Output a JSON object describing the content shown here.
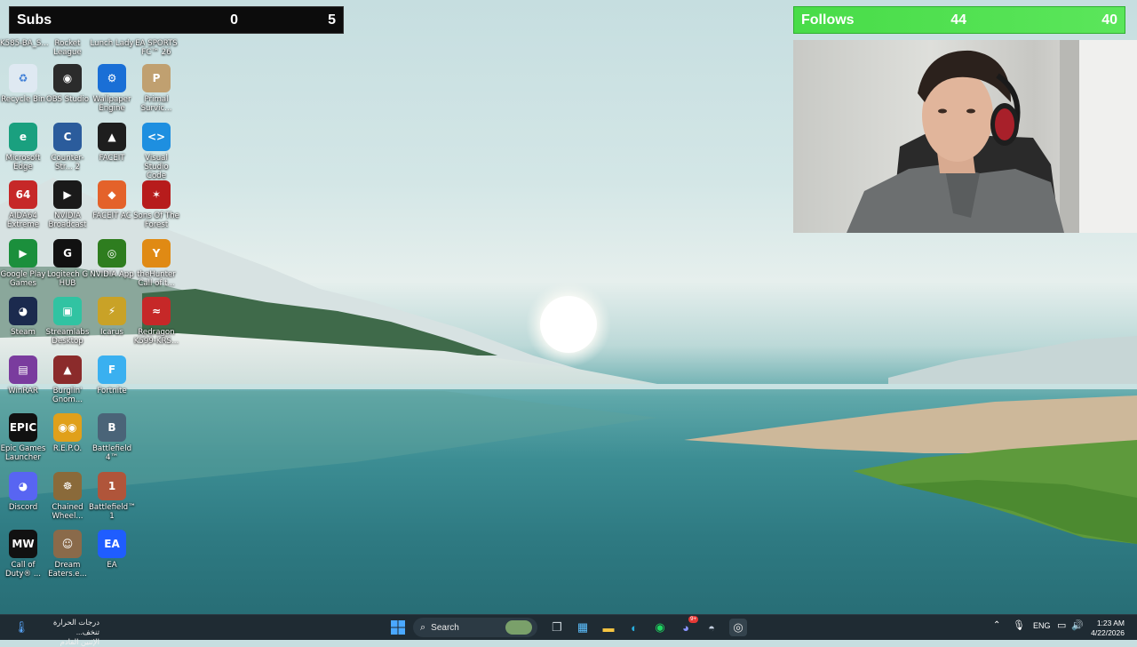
{
  "overlay": {
    "subs": {
      "label": "Subs",
      "current": "0",
      "goal": "5"
    },
    "follows": {
      "label": "Follows",
      "current": "44",
      "goal": "40"
    }
  },
  "top_labels": [
    "K585-BA_S...",
    "Rocket League",
    "Lunch Lady",
    "EA SPORTS FC™ 26"
  ],
  "icons": [
    {
      "label": "Recycle Bin",
      "icon": "recycle-bin-icon",
      "color": "#dfe9f2",
      "glyph": "♻"
    },
    {
      "label": "OBS Studio",
      "icon": "obs-icon",
      "color": "#2b2b2b",
      "glyph": "◉"
    },
    {
      "label": "Wallpaper Engine",
      "icon": "wallpaper-engine-icon",
      "color": "#1a6fd6",
      "glyph": "⚙"
    },
    {
      "label": "Primal Survic...",
      "icon": "primal-survival-icon",
      "color": "#c0a070",
      "glyph": "P"
    },
    {
      "label": "Microsoft Edge",
      "icon": "edge-icon",
      "color": "#1aa07f",
      "glyph": "e"
    },
    {
      "label": "Counter-Str... 2",
      "icon": "counter-strike-icon",
      "color": "#2b5c9c",
      "glyph": "C"
    },
    {
      "label": "FACEIT",
      "icon": "faceit-icon",
      "color": "#1e1e1e",
      "glyph": "▲"
    },
    {
      "label": "Visual Studio Code",
      "icon": "vscode-icon",
      "color": "#1e8fe0",
      "glyph": "<>"
    },
    {
      "label": "AIDA64 Extreme",
      "icon": "aida64-icon",
      "color": "#c62828",
      "glyph": "64"
    },
    {
      "label": "NVIDIA Broadcast",
      "icon": "nvidia-broadcast-icon",
      "color": "#1a1a1a",
      "glyph": "▶"
    },
    {
      "label": "FACEIT AC",
      "icon": "faceit-ac-icon",
      "color": "#e4622a",
      "glyph": "◆"
    },
    {
      "label": "Sons Of The Forest",
      "icon": "sons-of-the-forest-icon",
      "color": "#b71c1c",
      "glyph": "✶"
    },
    {
      "label": "Google Play Games",
      "icon": "google-play-games-icon",
      "color": "#1b8f3c",
      "glyph": "▶"
    },
    {
      "label": "Logitech G HUB",
      "icon": "logitech-ghub-icon",
      "color": "#111",
      "glyph": "G"
    },
    {
      "label": "NVIDIA App",
      "icon": "nvidia-app-icon",
      "color": "#2e7d1f",
      "glyph": "◎"
    },
    {
      "label": "theHunter Call of t...",
      "icon": "thehunter-icon",
      "color": "#e08a14",
      "glyph": "Y"
    },
    {
      "label": "Steam",
      "icon": "steam-icon",
      "color": "#1b2a4e",
      "glyph": "◕"
    },
    {
      "label": "Streamlabs Desktop",
      "icon": "streamlabs-icon",
      "color": "#31c3a2",
      "glyph": "▣"
    },
    {
      "label": "Icarus",
      "icon": "icarus-icon",
      "color": "#c9a227",
      "glyph": "⚡"
    },
    {
      "label": "Redragon K599-KRS...",
      "icon": "redragon-icon",
      "color": "#c62828",
      "glyph": "≈"
    },
    {
      "label": "WinRAR",
      "icon": "winrar-icon",
      "color": "#7a3c9e",
      "glyph": "▤"
    },
    {
      "label": "Burglin' Gnom...",
      "icon": "burglin-gnomes-icon",
      "color": "#8b2b2b",
      "glyph": "▲"
    },
    {
      "label": "Fortnite",
      "icon": "fortnite-icon",
      "color": "#3ab0f0",
      "glyph": "F"
    },
    {
      "label": "",
      "icon": "",
      "color": "",
      "glyph": ""
    },
    {
      "label": "Epic Games Launcher",
      "icon": "epic-games-icon",
      "color": "#111",
      "glyph": "EPIC"
    },
    {
      "label": "R.E.P.O.",
      "icon": "repo-icon",
      "color": "#e0a01a",
      "glyph": "◉◉"
    },
    {
      "label": "Battlefield 4™",
      "icon": "battlefield4-icon",
      "color": "#4a6478",
      "glyph": "B"
    },
    {
      "label": "",
      "icon": "",
      "color": "",
      "glyph": ""
    },
    {
      "label": "Discord",
      "icon": "discord-icon",
      "color": "#5865f2",
      "glyph": "◕"
    },
    {
      "label": "Chained Wheel...",
      "icon": "chained-wheels-icon",
      "color": "#8a6a3a",
      "glyph": "☸"
    },
    {
      "label": "Battlefield™ 1",
      "icon": "battlefield1-icon",
      "color": "#b0553a",
      "glyph": "1"
    },
    {
      "label": "",
      "icon": "",
      "color": "",
      "glyph": ""
    },
    {
      "label": "Call of Duty® ...",
      "icon": "call-of-duty-icon",
      "color": "#111",
      "glyph": "MW"
    },
    {
      "label": "Dream Eaters.e...",
      "icon": "dream-eaters-icon",
      "color": "#8a6a4a",
      "glyph": "☺"
    },
    {
      "label": "EA",
      "icon": "ea-icon",
      "color": "#1f5dff",
      "glyph": "EA"
    }
  ],
  "taskbar": {
    "weather_line1": "درجات الحرارة تنخف...",
    "weather_line2": "الإثنين القادم",
    "search_placeholder": "Search",
    "language": "ENG",
    "time": "1:23 AM",
    "date": "4/22/2026",
    "discord_badge": "9+"
  }
}
